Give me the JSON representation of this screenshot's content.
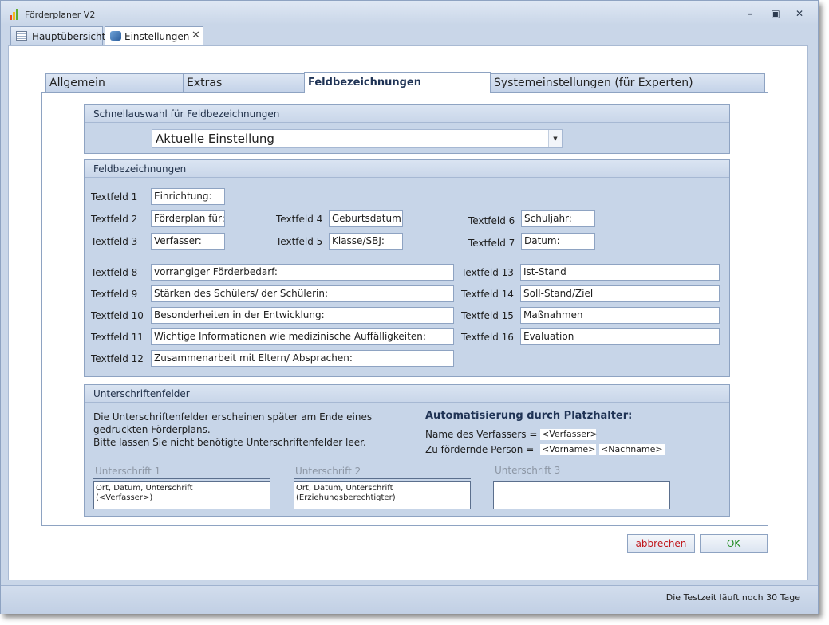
{
  "window": {
    "title": "Förderplaner V2"
  },
  "doc_tabs": [
    {
      "label": "Hauptübersicht"
    },
    {
      "label": "Einstellungen",
      "close": "✕"
    }
  ],
  "settings_tabs": [
    {
      "label": "Allgemein"
    },
    {
      "label": "Extras"
    },
    {
      "label": "Feldbezeichnungen"
    },
    {
      "label": "Systemeinstellungen (für Experten)"
    }
  ],
  "quick_select": {
    "title": "Schnellauswahl für Feldbezeichnungen",
    "value": "Aktuelle Einstellung"
  },
  "fields_group": {
    "title": "Feldbezeichnungen",
    "fields": [
      {
        "label": "Textfeld 1",
        "value": "Einrichtung:"
      },
      {
        "label": "Textfeld 2",
        "value": "Förderplan für:"
      },
      {
        "label": "Textfeld 3",
        "value": "Verfasser:"
      },
      {
        "label": "Textfeld 4",
        "value": "Geburtsdatum:"
      },
      {
        "label": "Textfeld 5",
        "value": "Klasse/SBJ:"
      },
      {
        "label": "Textfeld 6",
        "value": "Schuljahr:"
      },
      {
        "label": "Textfeld 7",
        "value": "Datum:"
      },
      {
        "label": "Textfeld 8",
        "value": "vorrangiger Förderbedarf:"
      },
      {
        "label": "Textfeld 9",
        "value": "Stärken des Schülers/ der Schülerin:"
      },
      {
        "label": "Textfeld 10",
        "value": "Besonderheiten in der Entwicklung:"
      },
      {
        "label": "Textfeld 11",
        "value": "Wichtige Informationen wie medizinische Auffälligkeiten:"
      },
      {
        "label": "Textfeld 12",
        "value": "Zusammenarbeit  mit Eltern/ Absprachen:"
      },
      {
        "label": "Textfeld 13",
        "value": "Ist-Stand"
      },
      {
        "label": "Textfeld 14",
        "value": "Soll-Stand/Ziel"
      },
      {
        "label": "Textfeld 15",
        "value": "Maßnahmen"
      },
      {
        "label": "Textfeld 16",
        "value": "Evaluation"
      }
    ]
  },
  "signatures": {
    "title": "Unterschriftenfelder",
    "info_lines": [
      "Die Unterschriftenfelder erscheinen später am Ende eines",
      "gedruckten Förderplans.",
      "Bitte lassen Sie nicht benötigte Unterschriftenfelder leer."
    ],
    "auto_title": "Automatisierung durch Platzhalter:",
    "author_label": "Name des Verfassers =",
    "author_placeholder": "<Verfasser>",
    "person_label": "Zu fördernde Person =",
    "firstname_placeholder": "<Vorname>",
    "lastname_placeholder": "<Nachname>",
    "fields": [
      {
        "title": "Unterschrift 1",
        "lines": [
          "Ort, Datum, Unterschrift",
          "(<Verfasser>)"
        ]
      },
      {
        "title": "Unterschrift 2",
        "lines": [
          "Ort, Datum, Unterschrift",
          "(Erziehungsberechtigter)"
        ]
      },
      {
        "title": "Unterschrift 3",
        "lines": [
          "",
          ""
        ]
      }
    ]
  },
  "buttons": {
    "cancel": "abbrechen",
    "ok": "OK"
  },
  "status": {
    "text": "Die Testzeit läuft noch 30 Tage"
  },
  "colors": {
    "cancel_text": "#c0171c",
    "ok_text": "#1f8a1f",
    "accent": "#1f3355"
  }
}
